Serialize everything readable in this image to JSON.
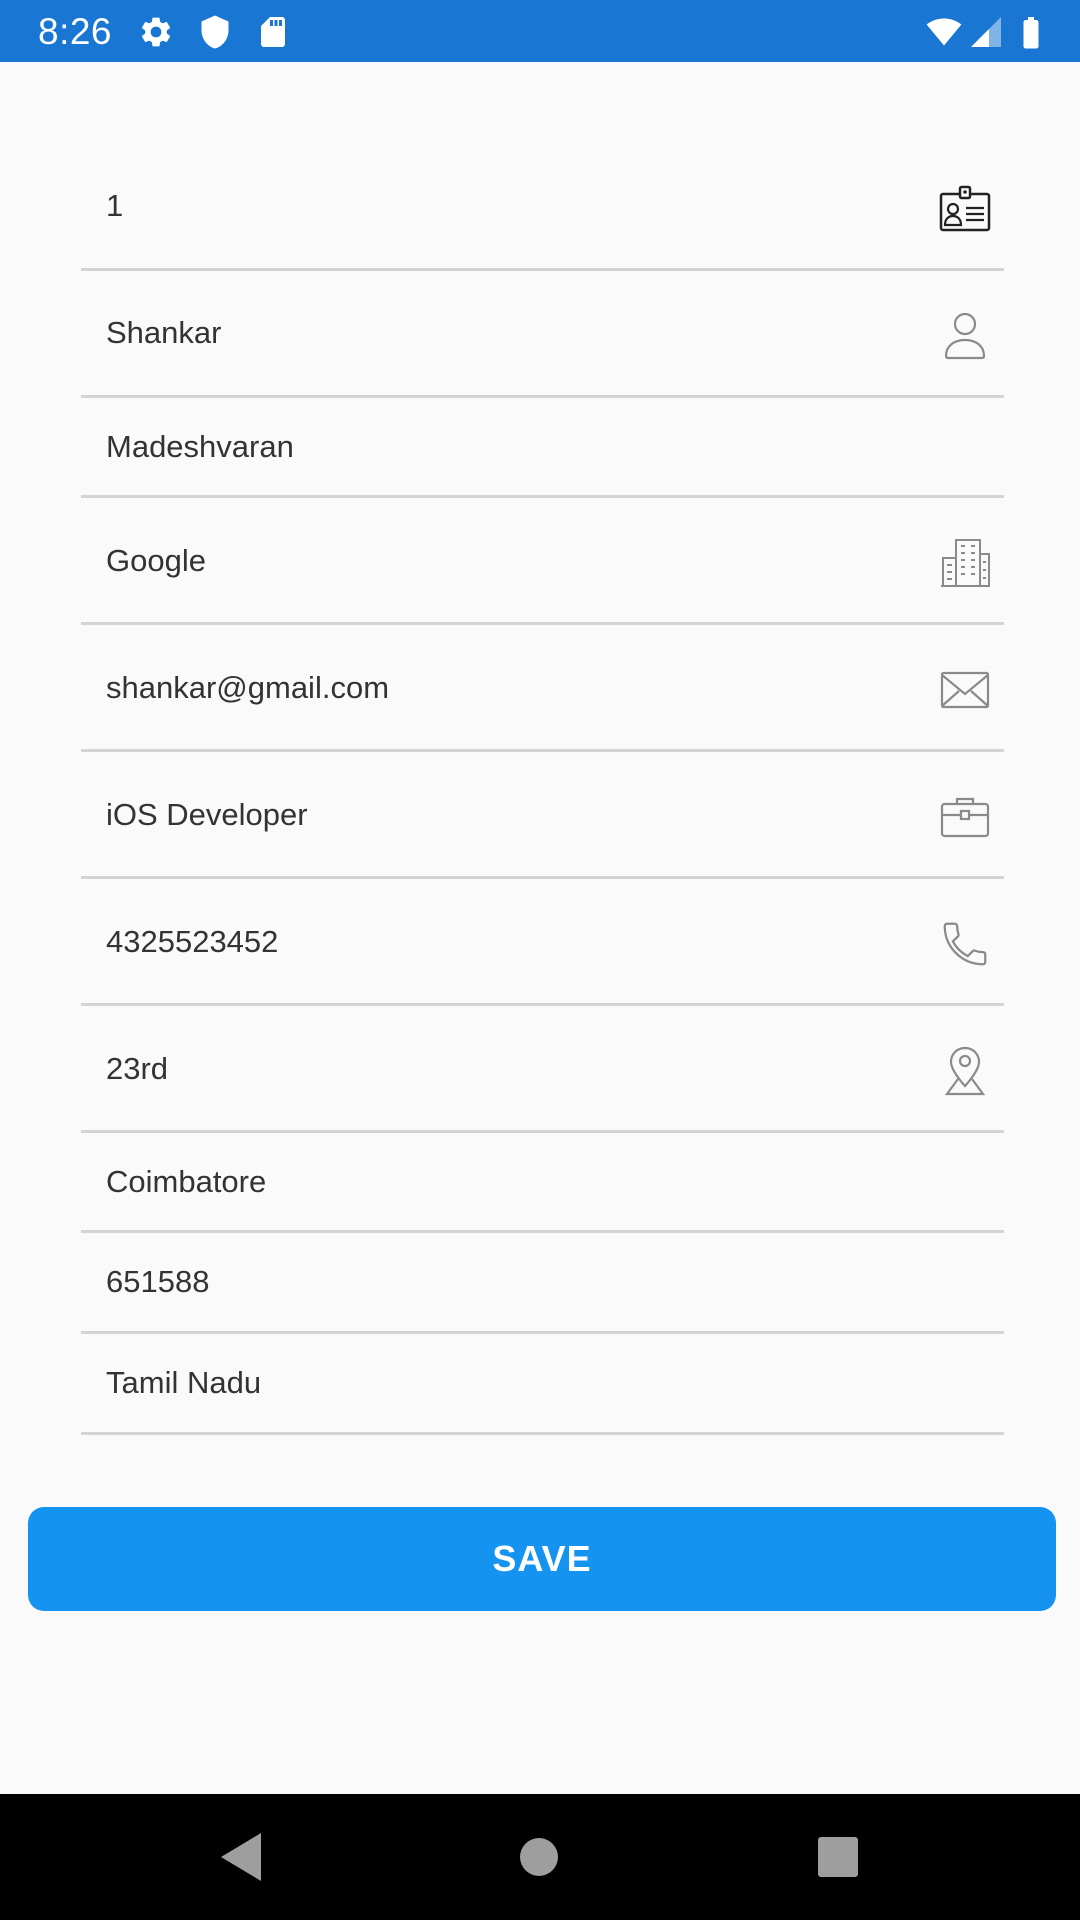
{
  "status_bar": {
    "time": "8:26",
    "icons": [
      "settings-icon",
      "shield-icon",
      "sd-card-icon",
      "wifi-icon",
      "signal-icon",
      "battery-icon"
    ],
    "background": "#1976d2"
  },
  "form": {
    "fields": [
      {
        "value": "1",
        "icon": "id-card-icon"
      },
      {
        "value": "Shankar",
        "icon": "person-icon"
      },
      {
        "value": "Madeshvaran",
        "icon": ""
      },
      {
        "value": "Google",
        "icon": "building-icon"
      },
      {
        "value": "shankar@gmail.com",
        "icon": "envelope-icon"
      },
      {
        "value": "iOS Developer",
        "icon": "briefcase-icon"
      },
      {
        "value": "4325523452",
        "icon": "phone-icon"
      },
      {
        "value": "23rd",
        "icon": "location-pin-icon"
      },
      {
        "value": "Coimbatore",
        "icon": ""
      },
      {
        "value": "651588",
        "icon": ""
      },
      {
        "value": "Tamil Nadu",
        "icon": ""
      }
    ]
  },
  "save_button": {
    "label": "SAVE",
    "color": "#1493f0"
  },
  "nav_bar": {
    "buttons": [
      "back-icon",
      "home-icon",
      "recents-icon"
    ]
  }
}
